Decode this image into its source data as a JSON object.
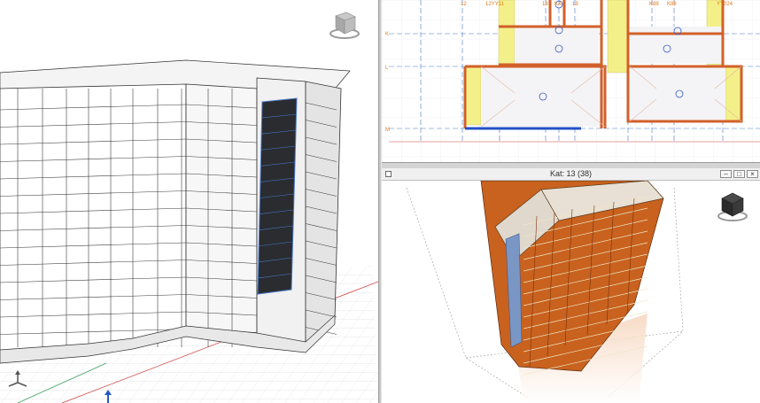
{
  "perspective_window": {
    "title": "Kat: 13 (38)",
    "minimize_glyph": "–",
    "maximize_glyph": "□",
    "close_glyph": "×"
  },
  "plan_view": {
    "axis_labels_top": [
      "12",
      "12YY11",
      "13",
      "KA",
      "13",
      "K88",
      "K88",
      "YY024"
    ],
    "axis_labels_left": [
      "K",
      "L",
      "M"
    ]
  },
  "colors": {
    "wall_orange": "#d2602a",
    "slab_yellow": "#f3f08a",
    "axis_blue": "#4a78c8",
    "panel_dark": "#2a2c30",
    "building_orange": "#c8621e",
    "grid_red": "#d04040"
  },
  "icons": {
    "view_cube": "view-cube-icon",
    "axis_gizmo": "axis-gizmo-icon"
  }
}
